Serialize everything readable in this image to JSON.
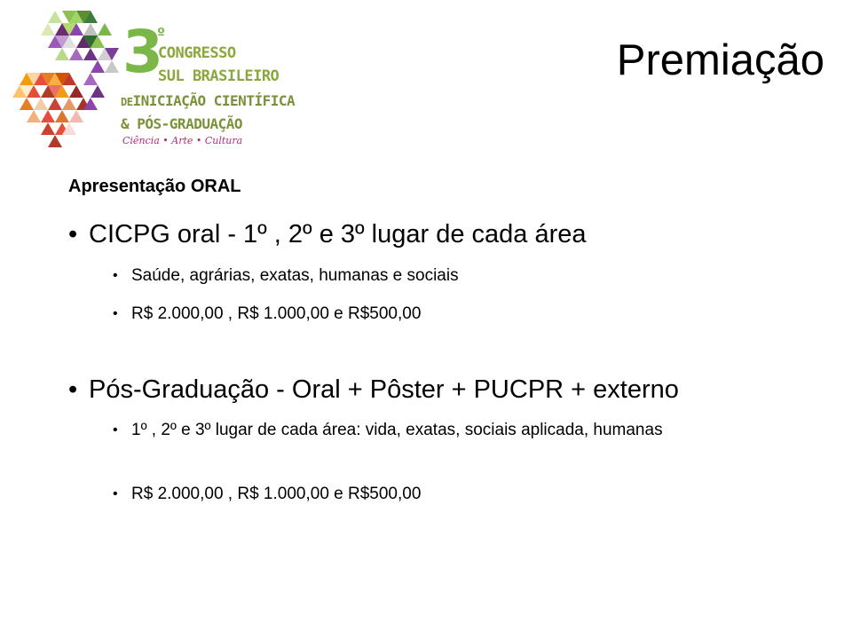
{
  "logo": {
    "big_number": "3",
    "ordinal": "º",
    "line1": "CONGRESSO",
    "line2": "SUL BRASILEIRO",
    "line3_prefix": "DE",
    "line3": "INICIAÇÃO CIENTÍFICA",
    "line4": "& PÓS-GRADUAÇÃO",
    "tagline": "Ciência • Arte • Cultura"
  },
  "title": "Premiação",
  "section_heading": "Apresentação ORAL",
  "bullets": [
    {
      "text": "CICPG oral  - 1º , 2º e 3º lugar de cada área",
      "sub": [
        "Saúde, agrárias, exatas, humanas e sociais",
        "R$ 2.000,00 , R$ 1.000,00 e R$500,00"
      ]
    },
    {
      "text": "Pós-Graduação  - Oral + Pôster + PUCPR + externo",
      "sub": [
        "1º , 2º e 3º lugar de cada área: vida, exatas, sociais aplicada, humanas",
        "R$ 2.000,00 , R$ 1.000,00 e R$500,00"
      ]
    }
  ],
  "bullet_glyph": "•"
}
